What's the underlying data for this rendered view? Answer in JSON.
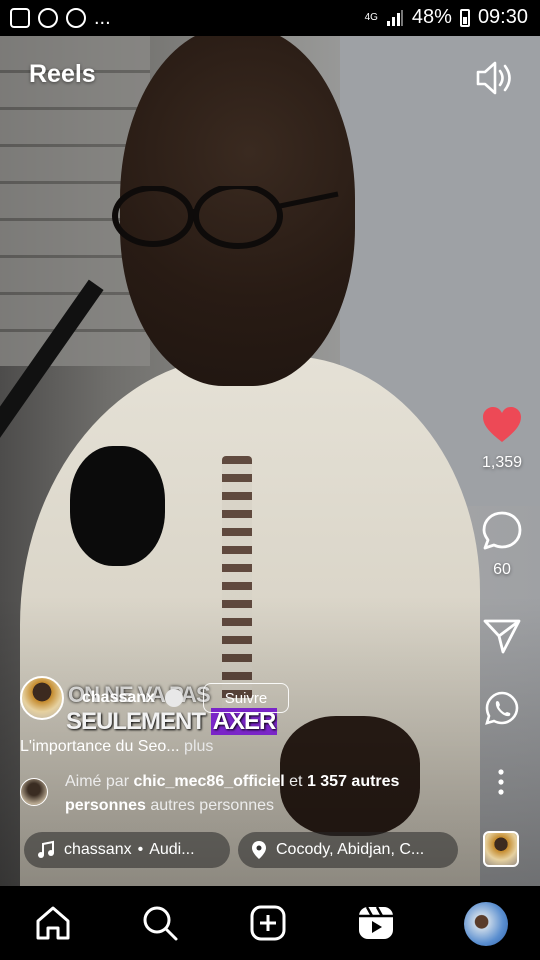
{
  "status_bar": {
    "network": "4G",
    "battery": "48%",
    "time": "09:30",
    "dots": "..."
  },
  "header": {
    "title": "Reels"
  },
  "actions": {
    "likes_count": "1,359",
    "comments_count": "60"
  },
  "post": {
    "author": "chassanx",
    "follow_label": "Suivre",
    "burned_text_line1": "ON NE VA PAS",
    "burned_text_line2a": "SEULEMENT",
    "burned_text_line2b": "AXER",
    "caption": "L'importance du Seo...",
    "caption_more": "plus",
    "liked_prefix": "Aimé par",
    "liked_user": "chic_mec86_officiel",
    "liked_and": "et",
    "liked_count": "1 357 autres",
    "liked_tail_bold": "personnes",
    "liked_tail": "autres personnes",
    "audio_author": "chassanx",
    "audio_bullet": "•",
    "audio_label": "Audi...",
    "location": "Cocody, Abidjan, C..."
  },
  "colors": {
    "like": "#ed4956",
    "highlight": "#7a25c8"
  },
  "icons": [
    "speaker-icon",
    "heart-icon",
    "comment-icon",
    "share-icon",
    "whatsapp-icon",
    "more-icon",
    "music-icon",
    "location-icon",
    "home-icon",
    "search-icon",
    "create-icon",
    "reels-icon",
    "profile-avatar"
  ]
}
